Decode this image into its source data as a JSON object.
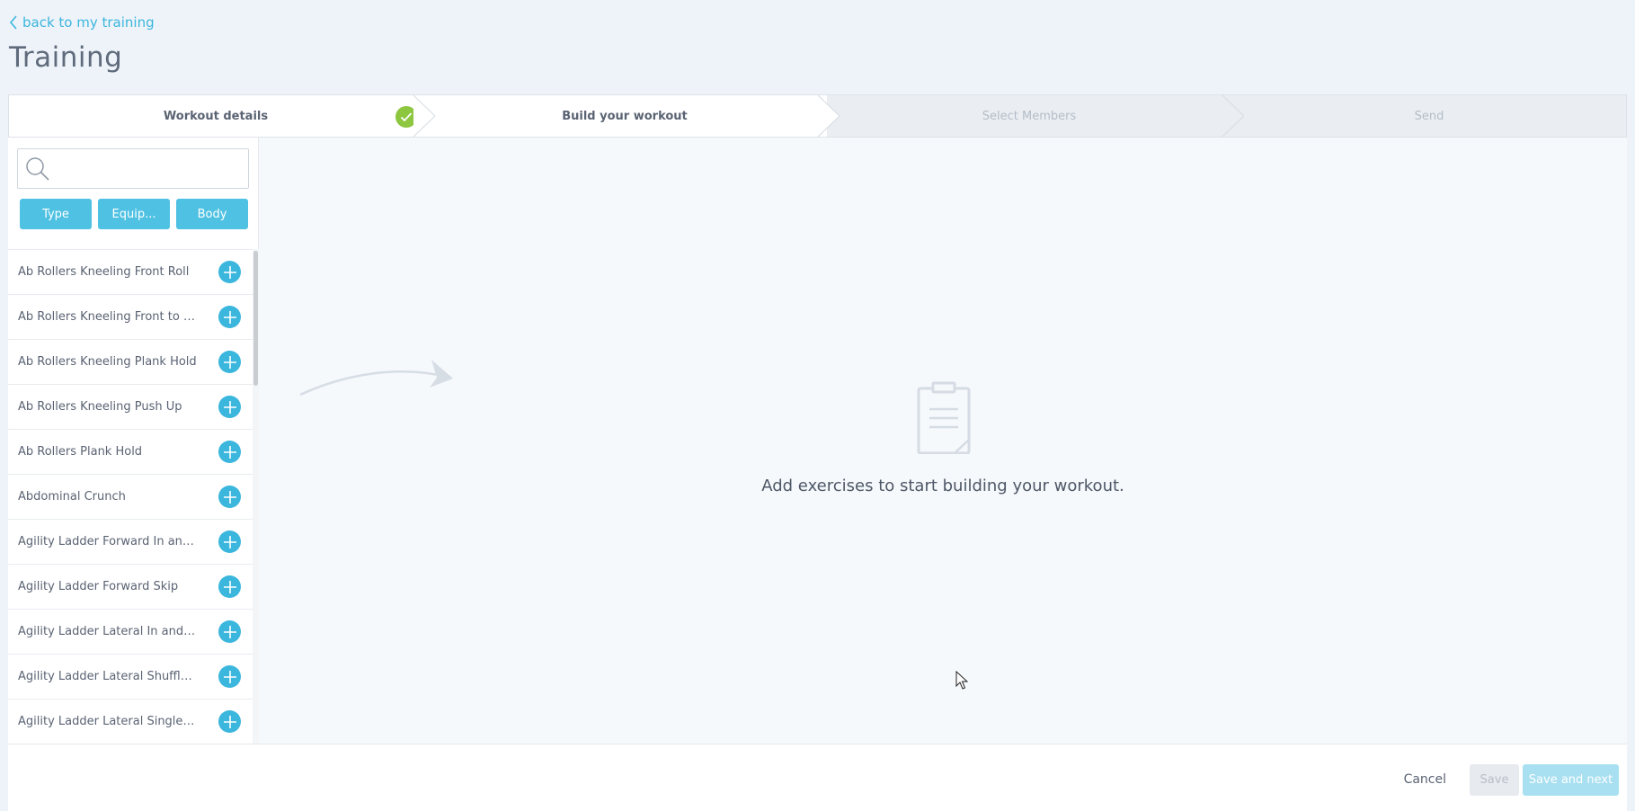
{
  "nav": {
    "back_label": "back to my training"
  },
  "page": {
    "title": "Training"
  },
  "stepper": {
    "steps": [
      {
        "label": "Workout details",
        "state": "done"
      },
      {
        "label": "Build your workout",
        "state": "active"
      },
      {
        "label": "Select Members",
        "state": "inactive"
      },
      {
        "label": "Send",
        "state": "inactive"
      }
    ]
  },
  "search": {
    "value": "",
    "placeholder": ""
  },
  "filters": {
    "type_label": "Type",
    "equipment_label": "Equip...",
    "body_label": "Body"
  },
  "exercises": [
    "Ab Rollers Kneeling Front Roll",
    "Ab Rollers Kneeling Front to Side R...",
    "Ab Rollers Kneeling Plank Hold",
    "Ab Rollers Kneeling Push Up",
    "Ab Rollers Plank Hold",
    "Abdominal Crunch",
    "Agility Ladder Forward In and Out ...",
    "Agility Ladder Forward Skip",
    "Agility Ladder Lateral In and Out R...",
    "Agility Ladder Lateral Shuffle Lunge",
    "Agility Ladder Lateral Single Leg H..."
  ],
  "main": {
    "empty_message": "Add exercises to start building your workout."
  },
  "footer": {
    "cancel_label": "Cancel",
    "save_label": "Save",
    "save_next_label": "Save and next"
  },
  "colors": {
    "accent": "#3bb6dd",
    "filter": "#4fc1e2",
    "success": "#8dc63f",
    "disabled_primary": "#a9e0f1"
  }
}
